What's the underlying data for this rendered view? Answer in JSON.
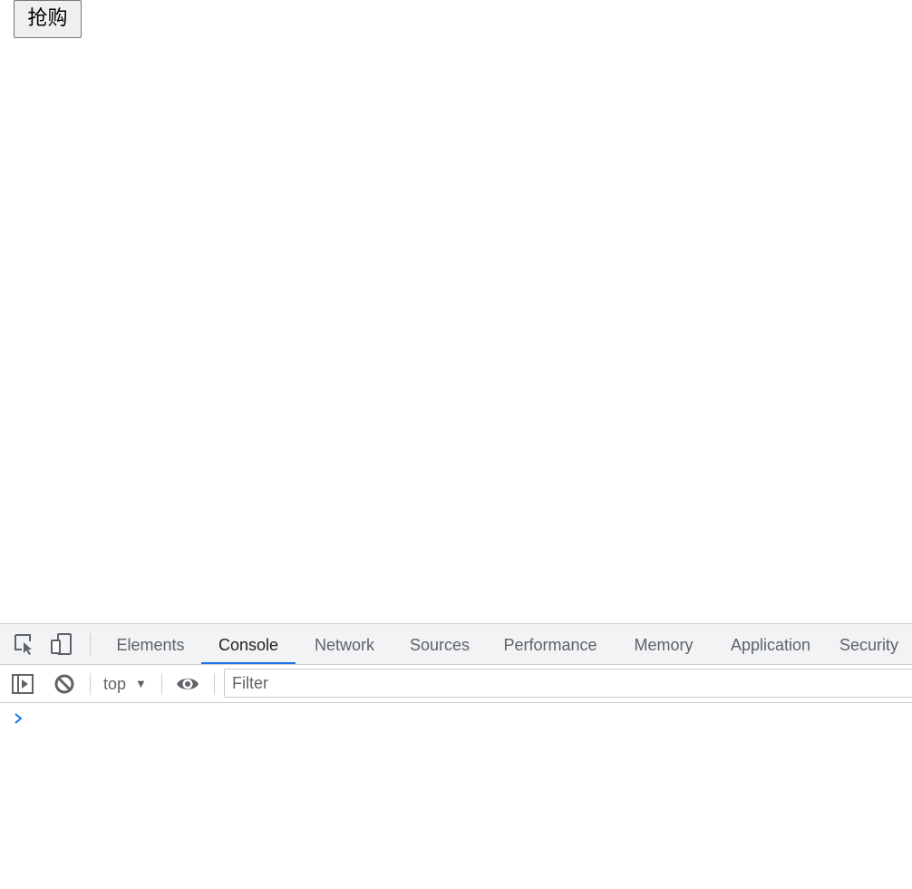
{
  "page": {
    "buy_button_label": "抢购"
  },
  "devtools": {
    "tabs": [
      {
        "label": "Elements",
        "active": false
      },
      {
        "label": "Console",
        "active": true
      },
      {
        "label": "Network",
        "active": false
      },
      {
        "label": "Sources",
        "active": false
      },
      {
        "label": "Performance",
        "active": false
      },
      {
        "label": "Memory",
        "active": false
      },
      {
        "label": "Application",
        "active": false
      },
      {
        "label": "Security",
        "active": false
      }
    ],
    "console_toolbar": {
      "context": "top",
      "filter_placeholder": "Filter",
      "filter_value": ""
    },
    "colors": {
      "accent": "#1a73e8",
      "tab_bg": "#f1f3f4",
      "prompt": "#1a73e8"
    },
    "icons": [
      "inspect-element-icon",
      "device-toggle-icon",
      "sidebar-toggle-icon",
      "clear-console-icon",
      "dropdown-arrow-icon",
      "live-expression-eye-icon",
      "console-prompt-chevron-icon"
    ]
  }
}
